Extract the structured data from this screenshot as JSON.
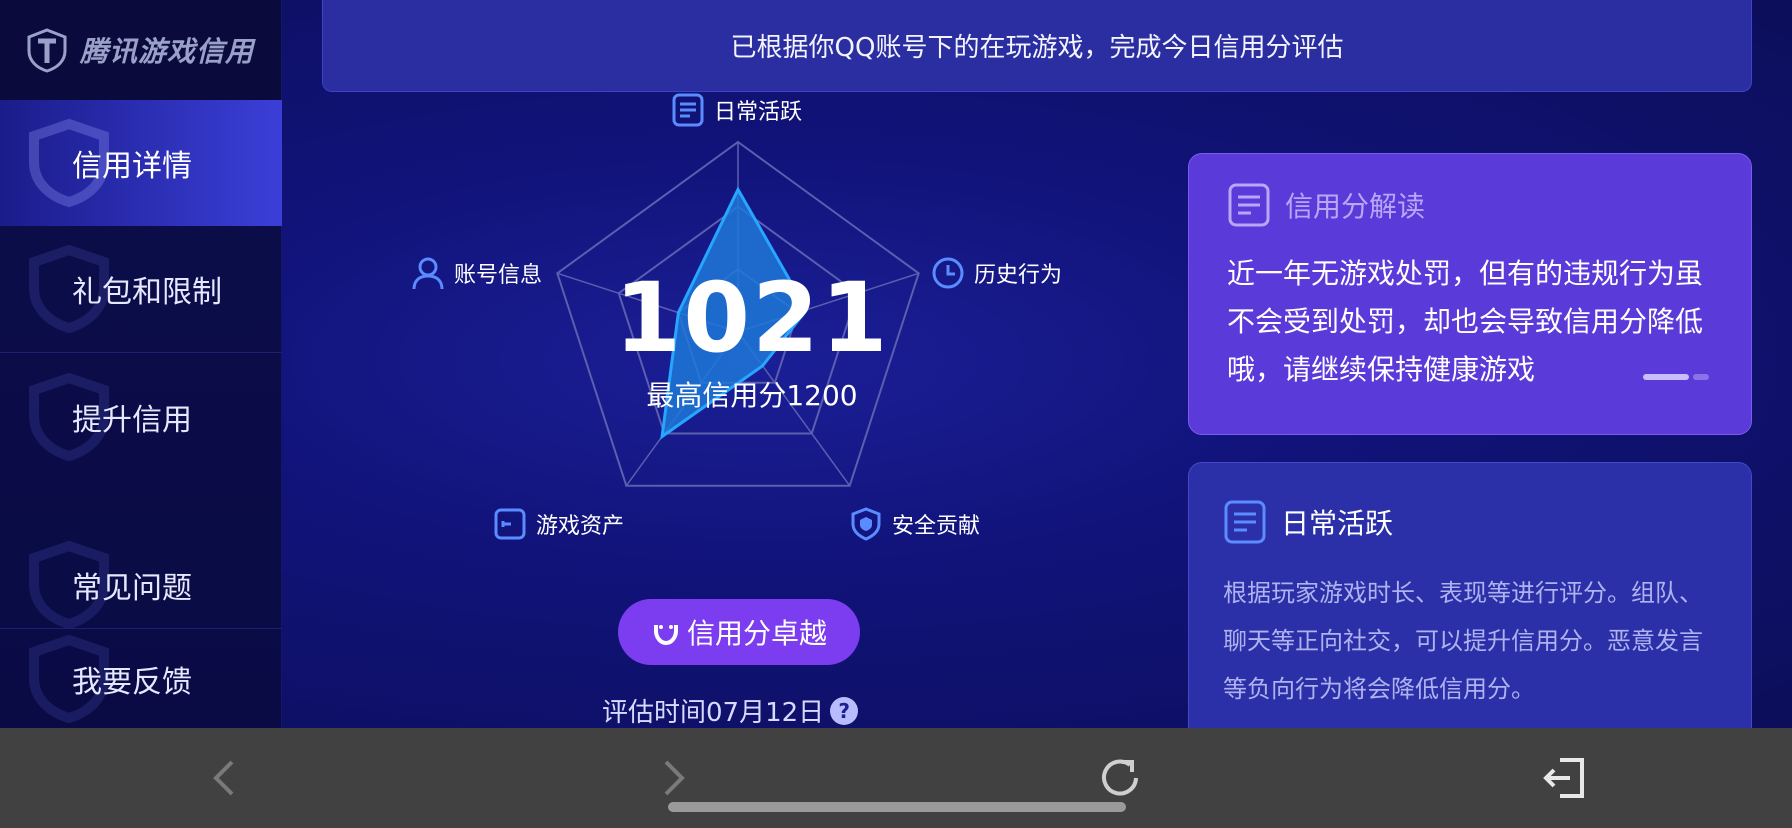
{
  "app": {
    "logo_text": "腾讯游戏信用"
  },
  "sidebar": {
    "items": [
      {
        "label": "信用详情",
        "active": true
      },
      {
        "label": "礼包和限制",
        "active": false
      },
      {
        "label": "提升信用",
        "active": false
      },
      {
        "label": "常见问题",
        "active": false
      },
      {
        "label": "我要反馈",
        "active": false
      }
    ]
  },
  "banner": {
    "text": "已根据你QQ账号下的在玩游戏，完成今日信用分评估"
  },
  "score": {
    "value": "1021",
    "max_text": "最高信用分1200",
    "level": "信用分卓越",
    "eval_time": "评估时间07月12日",
    "help": "?"
  },
  "radar": {
    "axes": [
      {
        "label": "日常活跃",
        "icon": "document-icon",
        "value": 0.75
      },
      {
        "label": "历史行为",
        "icon": "clock-icon",
        "value": 0.38
      },
      {
        "label": "安全贡献",
        "icon": "shield-icon",
        "value": 0.22
      },
      {
        "label": "游戏资产",
        "icon": "wallet-icon",
        "value": 0.68
      },
      {
        "label": "账号信息",
        "icon": "user-icon",
        "value": 0.33
      }
    ],
    "colors": {
      "fill": "#1e78d8",
      "stroke": "#26a6ff",
      "grid": "#5a5fb0"
    }
  },
  "card_interpret": {
    "title": "信用分解读",
    "lines": [
      "近一年无游戏处罚，但有的违规行为虽",
      "不会受到处罚，却也会导致信用分降低",
      "哦，请继续保持健康游戏"
    ]
  },
  "card_daily": {
    "title": "日常活跃",
    "lines": [
      "根据玩家游戏时长、表现等进行评分。组队、",
      "聊天等正向社交，可以提升信用分。恶意发言",
      "等负向行为将会降低信用分。"
    ]
  },
  "bottom_bar": {
    "icons": [
      "back-arrow-icon",
      "forward-arrow-icon",
      "refresh-icon",
      "exit-icon"
    ]
  }
}
